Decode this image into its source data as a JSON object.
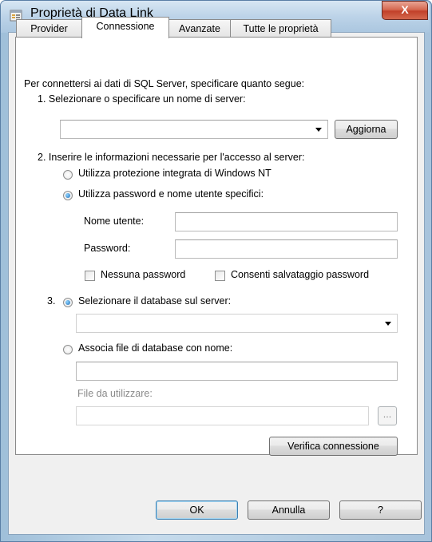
{
  "window": {
    "title": "Proprietà di Data Link",
    "close_symbol": "X"
  },
  "tabs": [
    {
      "label": "Provider"
    },
    {
      "label": "Connessione"
    },
    {
      "label": "Avanzate"
    },
    {
      "label": "Tutte le proprietà"
    }
  ],
  "connection": {
    "intro": "Per connettersi ai dati di SQL Server, specificare quanto segue:",
    "step1": "1. Selezionare o specificare un nome di server:",
    "server_value": "",
    "refresh_label": "Aggiorna",
    "step2": "2. Inserire le informazioni necessarie per l'accesso al server:",
    "radio_windows_nt": "Utilizza protezione integrata di Windows NT",
    "radio_user_pass": "Utilizza password e nome utente specifici:",
    "username_label": "Nome utente:",
    "username_value": "",
    "password_label": "Password:",
    "password_value": "",
    "no_password_label": "Nessuna password",
    "allow_save_label": "Consenti salvataggio password",
    "step3": "3.",
    "radio_select_db": "Selezionare il database sul server:",
    "database_value": "",
    "radio_attach_file": "Associa file di database con nome:",
    "attach_name_value": "",
    "file_label": "File da utilizzare:",
    "file_value": "",
    "browse_label": "...",
    "test_label": "Verifica connessione"
  },
  "footer": {
    "ok": "OK",
    "cancel": "Annulla",
    "help": "?"
  }
}
